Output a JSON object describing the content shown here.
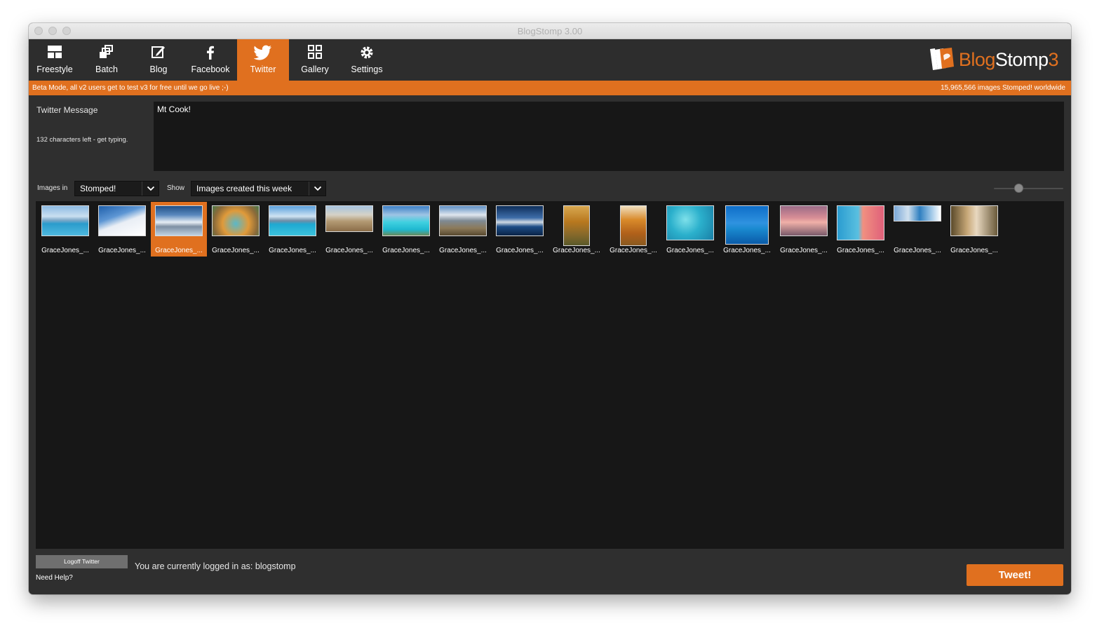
{
  "window": {
    "title": "BlogStomp 3.00"
  },
  "tabs": [
    {
      "label": "Freestyle",
      "icon": "freestyle-icon"
    },
    {
      "label": "Batch",
      "icon": "batch-icon"
    },
    {
      "label": "Blog",
      "icon": "blog-edit-icon"
    },
    {
      "label": "Facebook",
      "icon": "facebook-icon"
    },
    {
      "label": "Twitter",
      "icon": "twitter-icon",
      "active": true
    },
    {
      "label": "Gallery",
      "icon": "gallery-grid-icon"
    },
    {
      "label": "Settings",
      "icon": "gear-icon"
    }
  ],
  "logo": {
    "prefix": "Blog",
    "main": "Stomp",
    "suffix": "3"
  },
  "banner": {
    "left": "Beta Mode, all v2 users get to test v3 for free until we go live ;-)",
    "right": "15,965,566 images Stomped! worldwide"
  },
  "message": {
    "label": "Twitter Message",
    "chars_left": "132 characters left - get typing.",
    "value": "Mt Cook!"
  },
  "filters": {
    "images_in_label": "Images in",
    "images_in_value": "Stomped!",
    "show_label": "Show",
    "show_value": "Images created this week"
  },
  "thumbnails": [
    {
      "caption": "GraceJones_..."
    },
    {
      "caption": "GraceJones_..."
    },
    {
      "caption": "GraceJones_...",
      "selected": true
    },
    {
      "caption": "GraceJones_..."
    },
    {
      "caption": "GraceJones_..."
    },
    {
      "caption": "GraceJones_..."
    },
    {
      "caption": "GraceJones_..."
    },
    {
      "caption": "GraceJones_..."
    },
    {
      "caption": "GraceJones_..."
    },
    {
      "caption": "GraceJones_..."
    },
    {
      "caption": "GraceJones_..."
    },
    {
      "caption": "GraceJones_..."
    },
    {
      "caption": "GraceJones_..."
    },
    {
      "caption": "GraceJones_..."
    },
    {
      "caption": "GraceJones_..."
    },
    {
      "caption": "GraceJones_..."
    },
    {
      "caption": "GraceJones_..."
    }
  ],
  "footer": {
    "logoff_label": "Logoff Twitter",
    "help_label": "Need Help?",
    "logged_in_text": "You are currently logged in as: blogstomp",
    "tweet_label": "Tweet!"
  },
  "colors": {
    "accent": "#e0701f",
    "panel": "#2f2f2f",
    "field": "#171717"
  }
}
